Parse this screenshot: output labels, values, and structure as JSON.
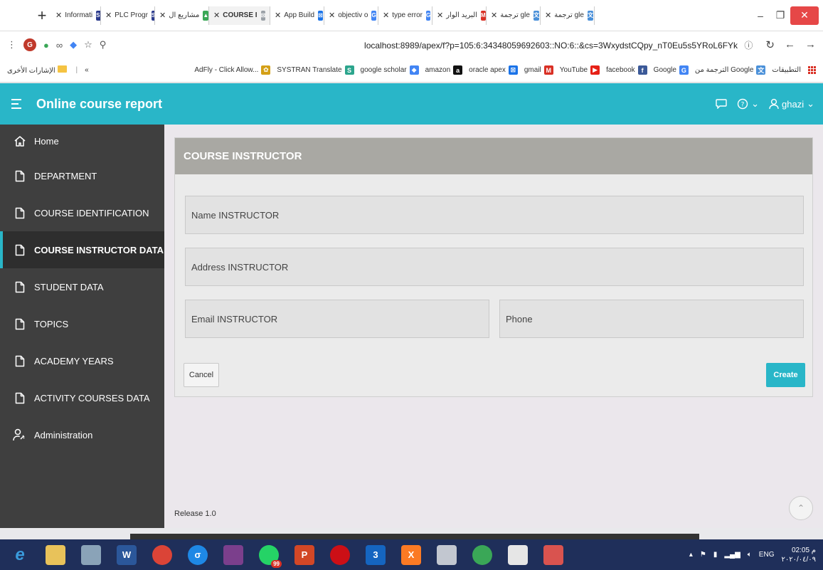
{
  "browser": {
    "tabs": [
      {
        "label": "Informati",
        "fav": "SF",
        "fav_color": "#2b3a8c"
      },
      {
        "label": "PLC Progr",
        "fav": "SF",
        "fav_color": "#2b3a8c"
      },
      {
        "label": "مشاريع ال",
        "fav": "▲",
        "fav_color": "#3aa757"
      },
      {
        "label": "COURSE I",
        "fav": "⊠",
        "fav_color": "#9aa0a6",
        "active": true
      },
      {
        "label": "App Build",
        "fav": "⊠",
        "fav_color": "#1a73e8"
      },
      {
        "label": "objectiv o",
        "fav": "G",
        "fav_color": "#4285f4"
      },
      {
        "label": "type error",
        "fav": "G",
        "fav_color": "#4285f4"
      },
      {
        "label": "البريد الوار",
        "fav": "M",
        "fav_color": "#d93025"
      },
      {
        "label": "ترجمة gle",
        "fav": "文",
        "fav_color": "#4a90d9"
      },
      {
        "label": "ترجمة gle",
        "fav": "文",
        "fav_color": "#4a90d9"
      }
    ],
    "url": "localhost:8989/apex/f?p=105:6:34348059692603::NO:6::&cs=3WxydstCQpy_nT0Eu5s5YRoL6FYk",
    "profile_initial": "G",
    "bookmarks_left": "الإشارات الأخرى",
    "bookmarks": [
      {
        "label": "AdFly - Click Allow...",
        "icon": "✿",
        "color": "#d4a017"
      },
      {
        "label": "SYSTRAN Translate",
        "icon": "S",
        "color": "#2ca58d"
      },
      {
        "label": "google scholar",
        "icon": "◆",
        "color": "#4285f4"
      },
      {
        "label": "amazon",
        "icon": "a",
        "color": "#111"
      },
      {
        "label": "oracle apex",
        "icon": "⊠",
        "color": "#1a73e8"
      },
      {
        "label": "gmail",
        "icon": "M",
        "color": "#d93025"
      },
      {
        "label": "YouTube",
        "icon": "▶",
        "color": "#e62117"
      },
      {
        "label": "facebook",
        "icon": "f",
        "color": "#3b5998"
      },
      {
        "label": "Google",
        "icon": "G",
        "color": "#4285f4"
      },
      {
        "label": "الترجمة من Google",
        "icon": "文",
        "color": "#4a90d9"
      },
      {
        "label": "التطبيقات",
        "icon": "",
        "color": ""
      }
    ]
  },
  "app": {
    "title": "Online course report",
    "user": "ghazi"
  },
  "sidebar": {
    "items": [
      {
        "label": "Home",
        "icon": "home-icon"
      },
      {
        "label": "DEPARTMENT",
        "icon": "page-icon"
      },
      {
        "label": "COURSE IDENTIFICATION",
        "icon": "page-icon"
      },
      {
        "label": "COURSE INSTRUCTOR DATA",
        "icon": "page-icon",
        "active": true
      },
      {
        "label": "STUDENT DATA",
        "icon": "page-icon"
      },
      {
        "label": "TOPICS",
        "icon": "page-icon"
      },
      {
        "label": "ACADEMY YEARS",
        "icon": "page-icon"
      },
      {
        "label": "ACTIVITY COURSES DATA",
        "icon": "page-icon"
      },
      {
        "label": "Administration",
        "icon": "user-key-icon"
      }
    ]
  },
  "form": {
    "region_title": "COURSE INSTRUCTOR",
    "name_placeholder": "Name INSTRUCTOR",
    "address_placeholder": "Address INSTRUCTOR",
    "email_placeholder": "Email INSTRUCTOR",
    "phone_placeholder": "Phone",
    "cancel_label": "Cancel",
    "create_label": "Create"
  },
  "footer": {
    "release": "Release 1.0"
  },
  "taskbar": {
    "lang": "ENG",
    "time": "02:05 م",
    "date": "٢٠٢٠/٠٤/٠٩",
    "badge": "99"
  }
}
